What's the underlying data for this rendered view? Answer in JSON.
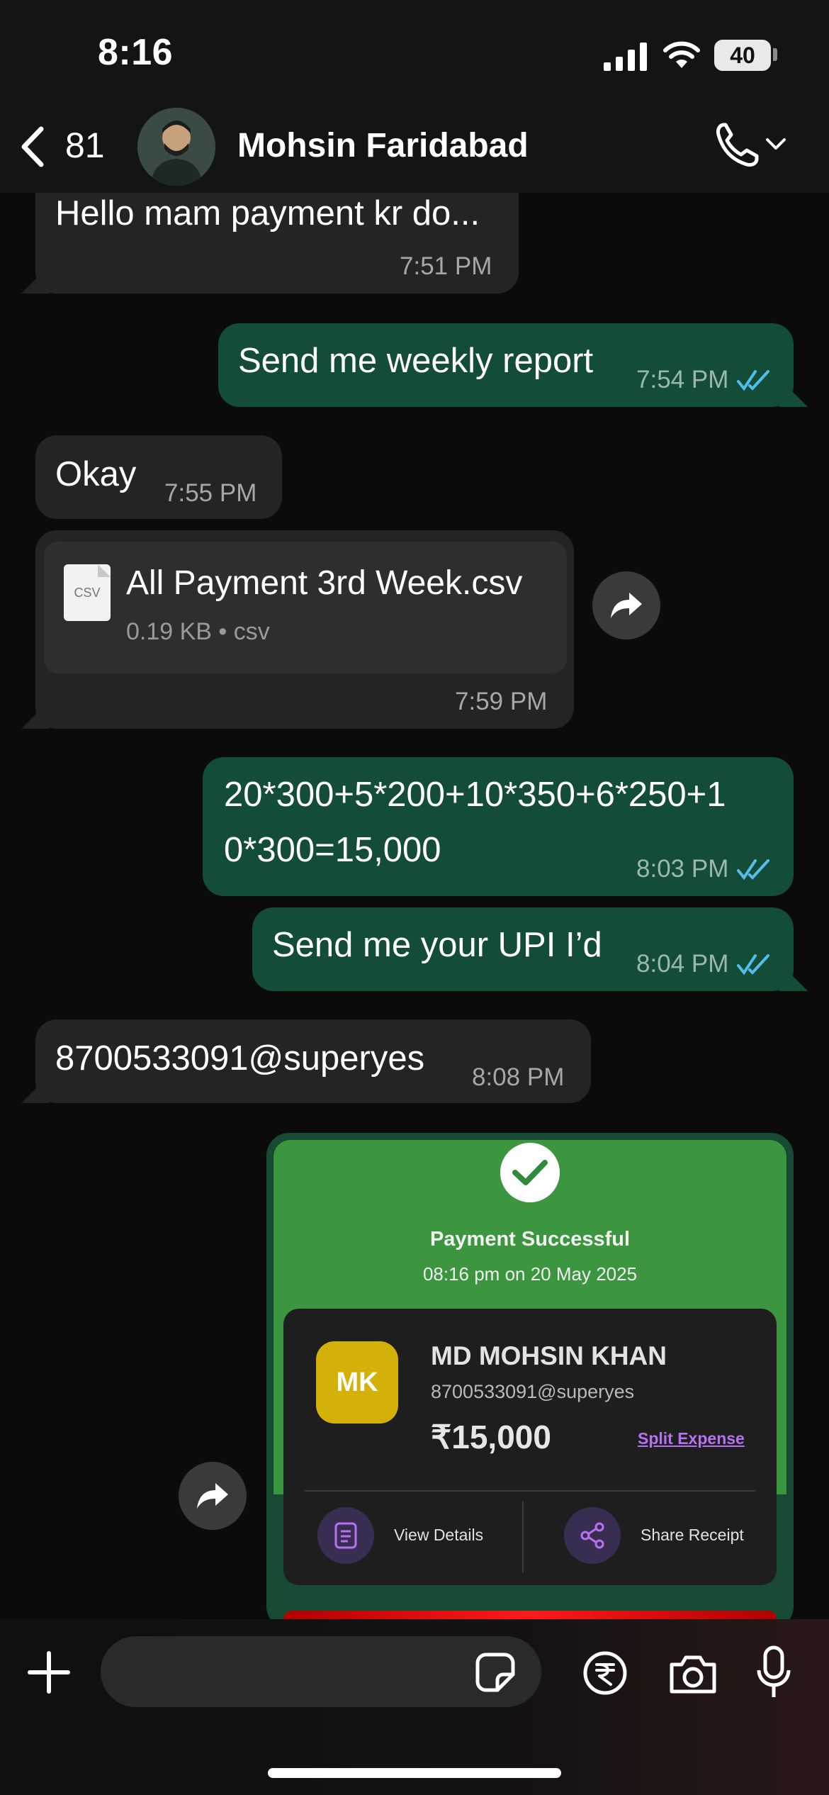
{
  "status_bar": {
    "time": "8:16",
    "battery": "40"
  },
  "header": {
    "back_count": "81",
    "contact_name": "Mohsin Faridabad"
  },
  "messages": [
    {
      "id": "m1",
      "direction": "in",
      "text": "Hello mam payment kr do...",
      "time": "7:51 PM"
    },
    {
      "id": "m2",
      "direction": "out",
      "text": "Send me weekly report",
      "time": "7:54 PM"
    },
    {
      "id": "m3",
      "direction": "in",
      "text": "Okay",
      "time": "7:55 PM"
    },
    {
      "id": "m4",
      "direction": "in",
      "type": "file",
      "file_name": "All Payment 3rd Week.csv",
      "file_meta": "0.19 KB • csv",
      "file_icon_label": "CSV",
      "time": "7:59 PM"
    },
    {
      "id": "m5",
      "direction": "out",
      "text_line1": "20*300+5*200+10*350+6*250+1",
      "text_line2": "0*300=15,000",
      "time": "8:03 PM"
    },
    {
      "id": "m6",
      "direction": "out",
      "text": "Send me your UPI I’d",
      "time": "8:04 PM"
    },
    {
      "id": "m7",
      "direction": "in",
      "text": "8700533091@superyes",
      "time": "8:08 PM"
    }
  ],
  "receipt": {
    "title": "Payment Successful",
    "datetime": "08:16 pm on 20 May 2025",
    "initials": "MK",
    "payee_name": "MD MOHSIN KHAN",
    "payee_upi": "8700533091@superyes",
    "amount": "₹15,000",
    "split_label": "Split Expense",
    "view_details_label": "View Details",
    "share_receipt_label": "Share Receipt"
  },
  "colors": {
    "outgoing_bubble": "#144d37",
    "incoming_bubble": "#242424",
    "read_ticks": "#53bdeb",
    "receipt_green": "#3c963f",
    "badge_yellow": "#d4b108",
    "split_purple": "#b772f0"
  }
}
